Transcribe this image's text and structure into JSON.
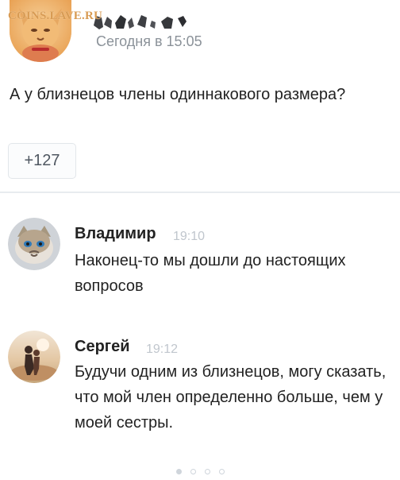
{
  "post": {
    "watermark": "COINS.LAVE.RU",
    "avatar_icon": "cat-avatar-icon",
    "author_redacted_icon": "redacted-name-icon",
    "timestamp": "Сегодня в 15:05",
    "text": "А у близнецов члены одиннакового размера?",
    "likes": "+127"
  },
  "comments": [
    {
      "author": "Владимир",
      "time": "19:10",
      "text": "Наконец-то мы дошли до настоящих вопросов",
      "avatar_icon": "grumpy-cat-avatar-icon"
    },
    {
      "author": "Сергей",
      "time": "19:12",
      "text": "Будучи одним из близнецов, могу сказать, что мой член определенно больше, чем у моей сестры.",
      "avatar_icon": "couple-silhouette-avatar-icon"
    }
  ],
  "pager": {
    "count": 4,
    "active_index": 0
  },
  "colors": {
    "text": "#222222",
    "meta": "#8b9299",
    "comment_time": "#c0c6cd",
    "divider": "#e8ebef",
    "watermark": "#d89b53"
  }
}
